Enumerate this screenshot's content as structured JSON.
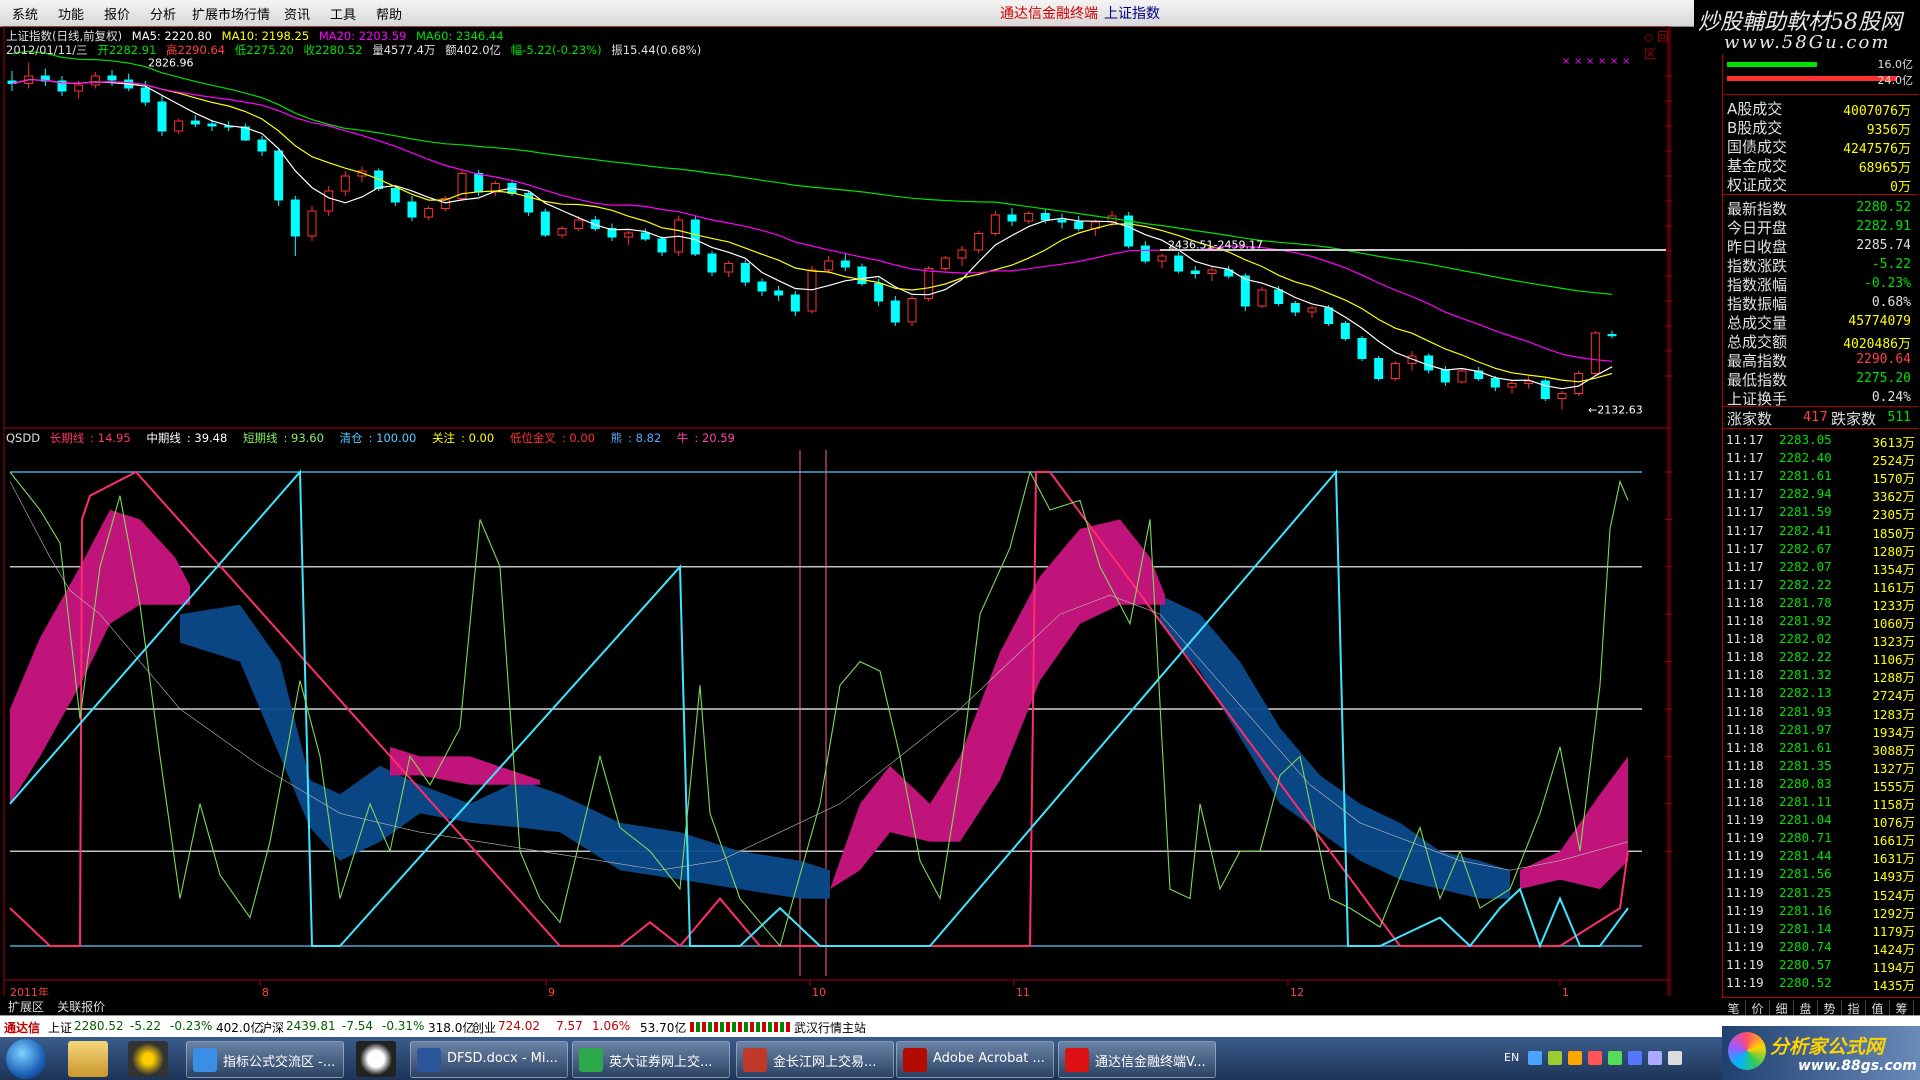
{
  "menu": [
    "系统",
    "功能",
    "报价",
    "分析",
    "扩展市场行情",
    "资讯",
    "工具",
    "帮助"
  ],
  "app": {
    "title": "通达信金融终端",
    "subtitle": "上证指数",
    "win_controls": "◇ 回 区"
  },
  "logo": {
    "title": "炒股輔助軟材58股网",
    "url": "www.58Gu.com"
  },
  "kline": {
    "title_line": {
      "name": "上证指数(日线,前复权)",
      "ma5": "MA5: 2220.80",
      "ma10": "MA10: 2198.25",
      "ma20": "MA20: 2203.59",
      "ma60": "MA60: 2346.44"
    },
    "ohlc_line": {
      "date": "2012/01/11/三",
      "open": "开2282.91",
      "high": "高2290.64",
      "low": "低2275.20",
      "close": "收2280.52",
      "vol": "量4577.4万",
      "amount": "额402.0亿",
      "change": "幅-5.22(-0.23%)",
      "amp": "振15.44(0.68%)"
    },
    "annotations": {
      "top": "2826.96",
      "range": "2436.51-2459.17",
      "bottom": "←2132.63"
    },
    "price_axis": [
      "2800",
      "2750",
      "2700",
      "2650",
      "2600",
      "2550",
      "2500",
      "2450",
      "2400",
      "2350",
      "2300",
      "2250",
      "2200"
    ],
    "date_axis": [
      "2011年",
      "8",
      "9",
      "10",
      "11",
      "12",
      "1"
    ],
    "period": "日线",
    "candles": [
      [
        2790,
        2810,
        2770,
        2785
      ],
      [
        2785,
        2826.96,
        2775,
        2800
      ],
      [
        2800,
        2815,
        2780,
        2790
      ],
      [
        2790,
        2800,
        2760,
        2770
      ],
      [
        2770,
        2790,
        2755,
        2782
      ],
      [
        2782,
        2808,
        2775,
        2800
      ],
      [
        2800,
        2812,
        2780,
        2792
      ],
      [
        2792,
        2805,
        2770,
        2776
      ],
      [
        2776,
        2790,
        2740,
        2748
      ],
      [
        2748,
        2760,
        2680,
        2690
      ],
      [
        2690,
        2715,
        2684,
        2710
      ],
      [
        2710,
        2722,
        2698,
        2704
      ],
      [
        2704,
        2712,
        2690,
        2700
      ],
      [
        2700,
        2710,
        2690,
        2698
      ],
      [
        2698,
        2705,
        2670,
        2672
      ],
      [
        2672,
        2680,
        2640,
        2650
      ],
      [
        2650,
        2655,
        2540,
        2552
      ],
      [
        2552,
        2560,
        2440,
        2480
      ],
      [
        2480,
        2540,
        2470,
        2530
      ],
      [
        2530,
        2580,
        2520,
        2570
      ],
      [
        2570,
        2610,
        2560,
        2600
      ],
      [
        2600,
        2618,
        2588,
        2610
      ],
      [
        2610,
        2615,
        2570,
        2575
      ],
      [
        2575,
        2580,
        2540,
        2548
      ],
      [
        2548,
        2560,
        2510,
        2518
      ],
      [
        2518,
        2540,
        2512,
        2535
      ],
      [
        2535,
        2560,
        2530,
        2555
      ],
      [
        2555,
        2610,
        2550,
        2605
      ],
      [
        2605,
        2612,
        2560,
        2568
      ],
      [
        2568,
        2590,
        2560,
        2585
      ],
      [
        2585,
        2592,
        2560,
        2565
      ],
      [
        2565,
        2570,
        2520,
        2528
      ],
      [
        2528,
        2535,
        2478,
        2482
      ],
      [
        2482,
        2500,
        2475,
        2495
      ],
      [
        2495,
        2520,
        2490,
        2512
      ],
      [
        2512,
        2520,
        2490,
        2495
      ],
      [
        2495,
        2505,
        2470,
        2478
      ],
      [
        2478,
        2490,
        2462,
        2486
      ],
      [
        2486,
        2495,
        2470,
        2474
      ],
      [
        2474,
        2480,
        2440,
        2448
      ],
      [
        2448,
        2520,
        2440,
        2512
      ],
      [
        2512,
        2520,
        2440,
        2444
      ],
      [
        2444,
        2450,
        2400,
        2408
      ],
      [
        2408,
        2430,
        2398,
        2425
      ],
      [
        2425,
        2432,
        2380,
        2388
      ],
      [
        2388,
        2395,
        2360,
        2370
      ],
      [
        2370,
        2380,
        2350,
        2362
      ],
      [
        2362,
        2370,
        2320,
        2330
      ],
      [
        2330,
        2420,
        2325,
        2412
      ],
      [
        2412,
        2440,
        2405,
        2430
      ],
      [
        2430,
        2445,
        2410,
        2418
      ],
      [
        2418,
        2425,
        2380,
        2385
      ],
      [
        2385,
        2395,
        2340,
        2350
      ],
      [
        2350,
        2360,
        2300,
        2308
      ],
      [
        2308,
        2360,
        2300,
        2355
      ],
      [
        2355,
        2420,
        2350,
        2415
      ],
      [
        2415,
        2440,
        2410,
        2436
      ],
      [
        2436,
        2460,
        2420,
        2452
      ],
      [
        2452,
        2490,
        2445,
        2485
      ],
      [
        2485,
        2530,
        2480,
        2522
      ],
      [
        2522,
        2536,
        2500,
        2510
      ],
      [
        2510,
        2530,
        2505,
        2525
      ],
      [
        2525,
        2535,
        2505,
        2512
      ],
      [
        2512,
        2525,
        2495,
        2508
      ],
      [
        2508,
        2520,
        2490,
        2495
      ],
      [
        2495,
        2512,
        2480,
        2508
      ],
      [
        2508,
        2530,
        2500,
        2520
      ],
      [
        2520,
        2528,
        2455,
        2460
      ],
      [
        2460,
        2470,
        2425,
        2430
      ],
      [
        2430,
        2445,
        2415,
        2440
      ],
      [
        2440,
        2448,
        2405,
        2410
      ],
      [
        2410,
        2420,
        2395,
        2405
      ],
      [
        2405,
        2418,
        2390,
        2412
      ],
      [
        2412,
        2420,
        2395,
        2400
      ],
      [
        2400,
        2405,
        2330,
        2340
      ],
      [
        2340,
        2378,
        2336,
        2372
      ],
      [
        2372,
        2380,
        2340,
        2345
      ],
      [
        2345,
        2350,
        2320,
        2328
      ],
      [
        2328,
        2340,
        2316,
        2336
      ],
      [
        2336,
        2342,
        2300,
        2305
      ],
      [
        2305,
        2310,
        2270,
        2275
      ],
      [
        2275,
        2280,
        2230,
        2235
      ],
      [
        2235,
        2240,
        2190,
        2195
      ],
      [
        2195,
        2230,
        2190,
        2225
      ],
      [
        2225,
        2250,
        2210,
        2240
      ],
      [
        2240,
        2245,
        2205,
        2212
      ],
      [
        2212,
        2220,
        2180,
        2188
      ],
      [
        2188,
        2215,
        2185,
        2210
      ],
      [
        2210,
        2218,
        2190,
        2195
      ],
      [
        2195,
        2200,
        2170,
        2178
      ],
      [
        2178,
        2190,
        2165,
        2185
      ],
      [
        2185,
        2200,
        2175,
        2190
      ],
      [
        2190,
        2195,
        2150,
        2155
      ],
      [
        2155,
        2170,
        2132.63,
        2165
      ],
      [
        2165,
        2210,
        2160,
        2205
      ],
      [
        2205,
        2290,
        2200,
        2286
      ],
      [
        2282.91,
        2290.64,
        2275.2,
        2280.52
      ]
    ]
  },
  "qsdd": {
    "name": "QSDD",
    "long": {
      "label": "长期线",
      "value": "14.95"
    },
    "mid": {
      "label": "中期线",
      "value": "39.48"
    },
    "short": {
      "label": "短期线",
      "value": "93.60"
    },
    "clear": {
      "label": "清仓",
      "value": "100.00"
    },
    "watch": {
      "label": "关注",
      "value": "0.00"
    },
    "golden": {
      "label": "低位金叉",
      "value": "0.00"
    },
    "ind1": {
      "label": "熊",
      "value": "8.82"
    },
    "ind2": {
      "label": "牛",
      "value": "20.59"
    },
    "axis": [
      "100.00",
      "90.00",
      "80.00",
      "70.00",
      "60.00",
      "50.00",
      "40.00",
      "30.00",
      "20.00"
    ]
  },
  "right_panel": {
    "bars": {
      "vol_top": "16.0亿",
      "vol_bottom": "24.0亿"
    },
    "stats1": [
      {
        "label": "A股成交",
        "value": "4007076万",
        "color": "#ffff00"
      },
      {
        "label": "B股成交",
        "value": "9356万",
        "color": "#ffff00"
      },
      {
        "label": "国债成交",
        "value": "4247576万",
        "color": "#ffff00"
      },
      {
        "label": "基金成交",
        "value": "68965万",
        "color": "#ffff00"
      },
      {
        "label": "权证成交",
        "value": "0万",
        "color": "#ffff00"
      }
    ],
    "stats2": [
      {
        "label": "最新指数",
        "value": "2280.52",
        "color": "#00e000"
      },
      {
        "label": "今日开盘",
        "value": "2282.91",
        "color": "#00e000"
      },
      {
        "label": "昨日收盘",
        "value": "2285.74",
        "color": "#e0e0e0"
      },
      {
        "label": "指数涨跌",
        "value": "-5.22",
        "color": "#00e000"
      },
      {
        "label": "指数涨幅",
        "value": "-0.23%",
        "color": "#00e000"
      },
      {
        "label": "指数振幅",
        "value": "0.68%",
        "color": "#e0e0e0"
      },
      {
        "label": "总成交量",
        "value": "45774079",
        "color": "#ffff00"
      },
      {
        "label": "总成交额",
        "value": "4020486万",
        "color": "#ffff00"
      },
      {
        "label": "最高指数",
        "value": "2290.64",
        "color": "#ff4040"
      },
      {
        "label": "最低指数",
        "value": "2275.20",
        "color": "#00e000"
      },
      {
        "label": "上证换手",
        "value": "0.24%",
        "color": "#e0e0e0"
      }
    ],
    "updown": {
      "up_label": "涨家数",
      "up": "417",
      "down_label": "跌家数",
      "down": "511"
    },
    "ticks": [
      [
        "11:17",
        "2283.05",
        "3613万"
      ],
      [
        "11:17",
        "2282.40",
        "2524万"
      ],
      [
        "11:17",
        "2281.61",
        "1570万"
      ],
      [
        "11:17",
        "2282.94",
        "3362万"
      ],
      [
        "11:17",
        "2281.59",
        "2305万"
      ],
      [
        "11:17",
        "2282.41",
        "1850万"
      ],
      [
        "11:17",
        "2282.67",
        "1280万"
      ],
      [
        "11:17",
        "2282.07",
        "1354万"
      ],
      [
        "11:17",
        "2282.22",
        "1161万"
      ],
      [
        "11:18",
        "2281.78",
        "1233万"
      ],
      [
        "11:18",
        "2281.92",
        "1060万"
      ],
      [
        "11:18",
        "2282.02",
        "1323万"
      ],
      [
        "11:18",
        "2282.22",
        "1106万"
      ],
      [
        "11:18",
        "2281.32",
        "1288万"
      ],
      [
        "11:18",
        "2282.13",
        "2724万"
      ],
      [
        "11:18",
        "2281.93",
        "1283万"
      ],
      [
        "11:18",
        "2281.97",
        "1934万"
      ],
      [
        "11:18",
        "2281.61",
        "3088万"
      ],
      [
        "11:18",
        "2281.35",
        "1327万"
      ],
      [
        "11:18",
        "2280.83",
        "1555万"
      ],
      [
        "11:18",
        "2281.11",
        "1158万"
      ],
      [
        "11:19",
        "2281.04",
        "1076万"
      ],
      [
        "11:19",
        "2280.71",
        "1661万"
      ],
      [
        "11:19",
        "2281.44",
        "1631万"
      ],
      [
        "11:19",
        "2281.56",
        "1493万"
      ],
      [
        "11:19",
        "2281.25",
        "1524万"
      ],
      [
        "11:19",
        "2281.16",
        "1292万"
      ],
      [
        "11:19",
        "2281.14",
        "1179万"
      ],
      [
        "11:19",
        "2280.74",
        "1424万"
      ],
      [
        "11:19",
        "2280.57",
        "1194万"
      ],
      [
        "11:19",
        "2280.52",
        "1435万"
      ]
    ],
    "tabs": [
      "笔",
      "价",
      "细",
      "盘",
      "势",
      "指",
      "值",
      "筹"
    ]
  },
  "bottom_tabs": [
    "扩展区",
    "关联报价"
  ],
  "status_bar": {
    "brand": "通达信",
    "sh_label": "上证",
    "sh_val": "2280.52",
    "sh_chg": "-5.22",
    "sh_pct": "-0.23%",
    "sh_amt": "402.0亿",
    "sz_label": "沪深",
    "sz_val": "2439.81",
    "sz_chg": "-7.54",
    "sz_pct": "-0.31%",
    "sz_amt": "318.0亿",
    "cy_label": "创业",
    "cy_val": "724.02",
    "cy_chg": "7.57",
    "cy_pct": "1.06%",
    "cy_amt": "53.70亿",
    "station": "武汉行情主站"
  },
  "taskbar": {
    "tasks": [
      {
        "label": "指标公式交流区 -...",
        "color": "#3a8ee6"
      },
      {
        "label": "DFSD.docx - Mi...",
        "color": "#2b579a"
      },
      {
        "label": "英大证券网上交...",
        "color": "#2aa84a"
      },
      {
        "label": "金长江网上交易...",
        "color": "#c0392b"
      },
      {
        "label": "Adobe Acrobat ...",
        "color": "#b30b00"
      },
      {
        "label": "通达信金融终端V...",
        "color": "#d11"
      }
    ],
    "tray_lang": "EN"
  },
  "ad": {
    "title": "分析家公式网",
    "url": "www.88gs.com"
  },
  "colors": {
    "up": "#ff3030",
    "down": "#00ffff",
    "ma5": "#ffffff",
    "ma10": "#ffff00",
    "ma20": "#ff00ff",
    "ma60": "#00e000"
  }
}
